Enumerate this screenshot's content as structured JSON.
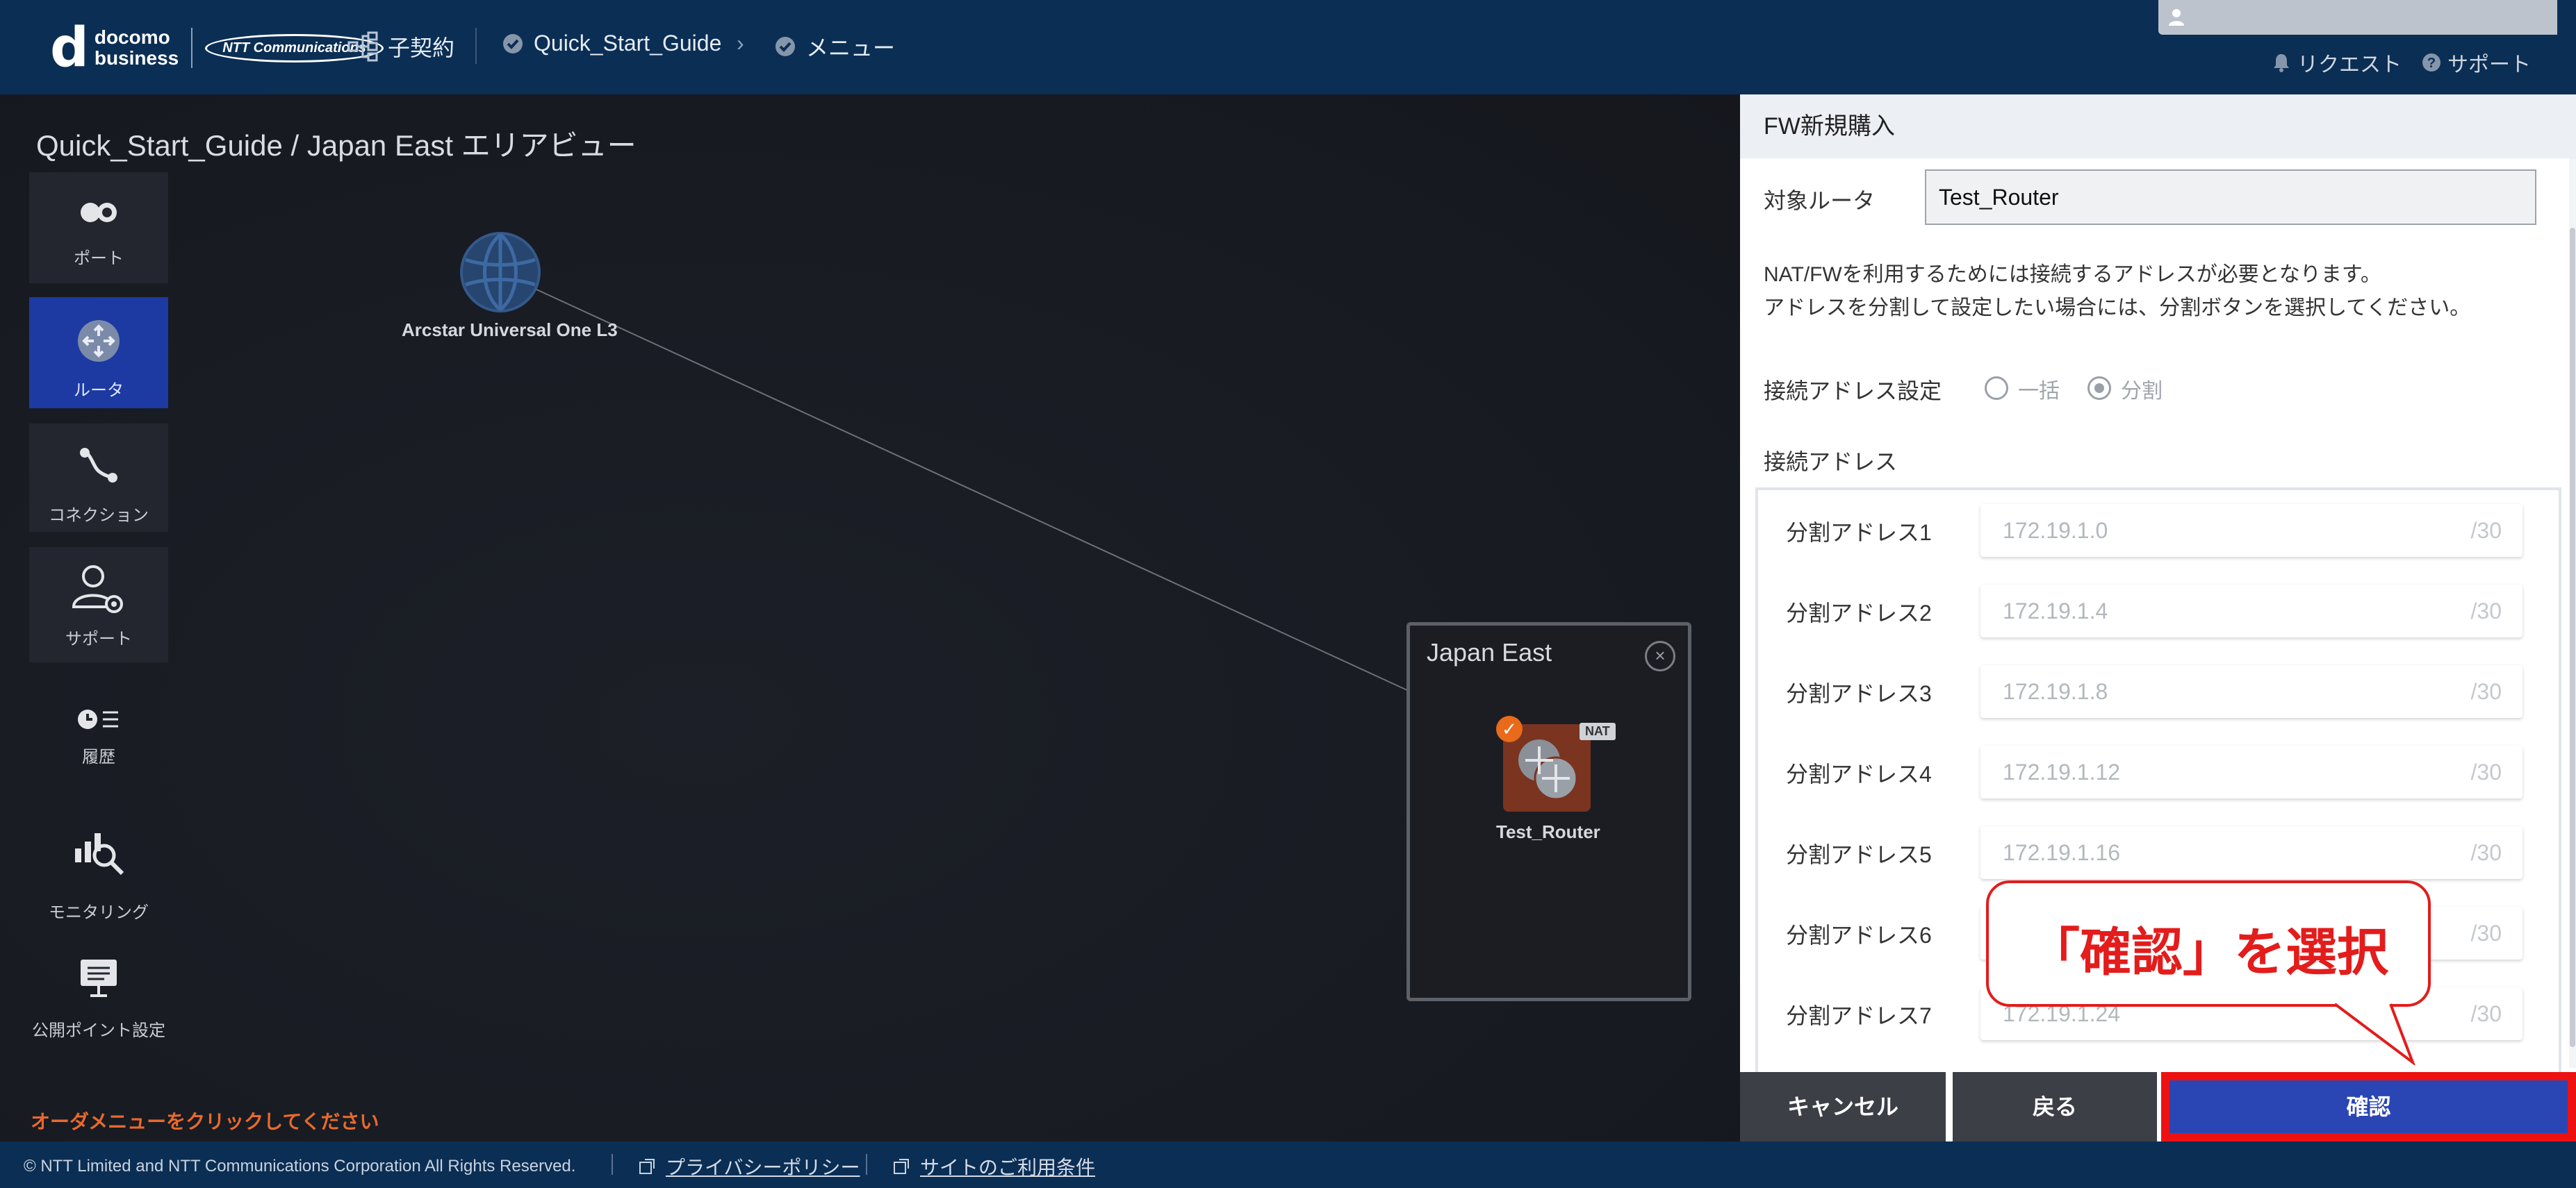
{
  "header": {
    "logo_text_1": "docomo",
    "logo_text_2": "business",
    "ntt_logo": "NTT Communications",
    "contract": "子契約",
    "guide": "Quick_Start_Guide",
    "menu": "メニュー",
    "request": "リクエスト",
    "support": "サポート"
  },
  "canvas": {
    "title": "Quick_Start_Guide / Japan East エリアビュー",
    "order_message": "オーダメニューをクリックしてください",
    "arcstar_label": "Arcstar Universal One L3",
    "area_title": "Japan East",
    "router_label": "Test_Router",
    "nat_badge": "NAT"
  },
  "side_menu": [
    {
      "label": "ポート",
      "icon": "port-icon"
    },
    {
      "label": "ルータ",
      "icon": "router-icon"
    },
    {
      "label": "コネクション",
      "icon": "connection-icon"
    },
    {
      "label": "サポート",
      "icon": "support-icon"
    },
    {
      "label": "履歴",
      "icon": "history-icon"
    },
    {
      "label": "モニタリング",
      "icon": "monitoring-icon"
    },
    {
      "label": "公開ポイント設定",
      "icon": "public-point-icon"
    }
  ],
  "panel": {
    "title": "FW新規購入",
    "target_router_label": "対象ルータ",
    "target_router_value": "Test_Router",
    "info_line_1": "NAT/FWを利用するためには接続するアドレスが必要となります。",
    "info_line_2": "アドレスを分割して設定したい場合には、分割ボタンを選択してください。",
    "address_setting_label": "接続アドレス設定",
    "radio_bulk": "一括",
    "radio_split": "分割",
    "address_section_label": "接続アドレス",
    "addresses": [
      {
        "label": "分割アドレス1",
        "value": "172.19.1.0",
        "suffix": "/30"
      },
      {
        "label": "分割アドレス2",
        "value": "172.19.1.4",
        "suffix": "/30"
      },
      {
        "label": "分割アドレス3",
        "value": "172.19.1.8",
        "suffix": "/30"
      },
      {
        "label": "分割アドレス4",
        "value": "172.19.1.12",
        "suffix": "/30"
      },
      {
        "label": "分割アドレス5",
        "value": "172.19.1.16",
        "suffix": "/30"
      },
      {
        "label": "分割アドレス6",
        "value": "",
        "suffix": "/30"
      },
      {
        "label": "分割アドレス7",
        "value": "172.19.1.24",
        "suffix": "/30"
      }
    ],
    "cancel": "キャンセル",
    "back": "戻る",
    "confirm": "確認"
  },
  "callout": {
    "text": "「確認」を選択"
  },
  "footer": {
    "copyright": "© NTT Limited and NTT Communications Corporation All Rights Reserved.",
    "privacy": "プライバシーポリシー",
    "terms": "サイトのご利用条件"
  },
  "colors": {
    "header_bg": "#0b2e54",
    "active_menu": "#1d3aa3",
    "confirm_button": "#2a46b4",
    "highlight_red": "#e31c1c",
    "order_message": "#e8692d"
  }
}
